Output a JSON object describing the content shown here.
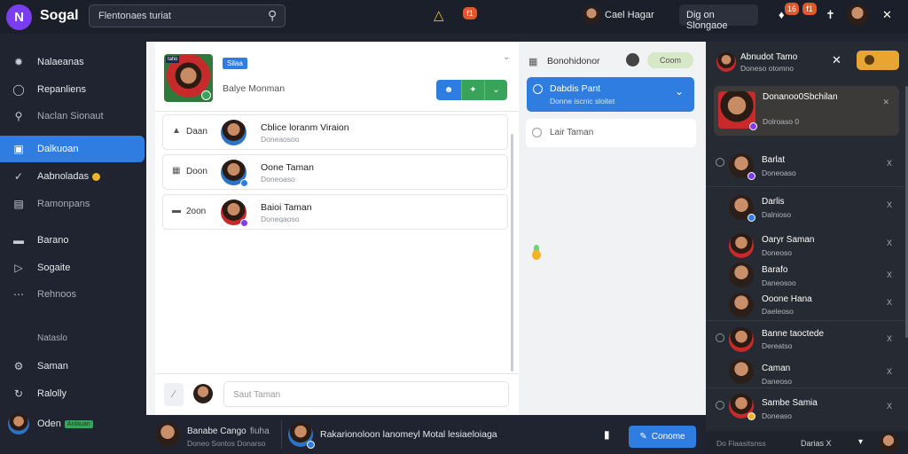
{
  "app": {
    "logo_glyph": "N",
    "name": "Sogal"
  },
  "search": {
    "value": "Flentonaes turiat"
  },
  "topbar": {
    "alert_badge": "f1",
    "user_name": "Cael Hagar",
    "sign_in_text": "Dig on Slongaoe",
    "notif_badge_1": "16",
    "notif_badge_2": "f1"
  },
  "sidebar": {
    "items": [
      {
        "icon": "settings-icon",
        "label": "Nalaeanas"
      },
      {
        "icon": "chat-icon",
        "label": "Repanliens"
      },
      {
        "icon": "search-icon",
        "label": "Naclan Sionaut"
      },
      {
        "icon": "dashboard-icon",
        "label": "Dalkuoan"
      },
      {
        "icon": "check-icon",
        "label": "Aabnoladas"
      },
      {
        "icon": "stats-icon",
        "label": "Ramonpans"
      },
      {
        "icon": "layers-icon",
        "label": "Barano"
      },
      {
        "icon": "play-icon",
        "label": "Sogaite"
      },
      {
        "icon": "more-icon",
        "label": "Rehnoos"
      }
    ],
    "section_header": "Nataslo",
    "bottom_items": [
      {
        "icon": "gear-icon",
        "label": "Saman"
      },
      {
        "icon": "refresh-icon",
        "label": "Ralolly"
      }
    ],
    "profile": {
      "name": "Oden",
      "tag": "Anlauan"
    }
  },
  "left_panel": {
    "header": {
      "tag": "Silaa",
      "subtitle": "Balye Monman",
      "mini_tag": "tatio"
    },
    "rows": [
      {
        "icon": "home-icon",
        "label": "Daan",
        "name": "Cblice loranm Viraion",
        "sub": "Doneaosoo"
      },
      {
        "icon": "doc-icon",
        "label": "Doon",
        "name": "Oone Taman",
        "sub": "Doneoaso"
      },
      {
        "icon": "list-icon",
        "label": "2oon",
        "name": "Baioi Taman",
        "sub": "Doneqaoso"
      }
    ],
    "composer": {
      "placeholder": "Saut Taman"
    }
  },
  "mid_panel": {
    "title": "Bonohidonor",
    "toggle_label": "Coom",
    "selected": {
      "title": "Dabdis Pant",
      "sub": "Donne iscnic sloitet"
    },
    "item": "Lair Taman"
  },
  "right_panel": {
    "header_name": "Abnudot Tamo",
    "header_sub": "Doneso otomno",
    "featured": {
      "name": "Donanoo0Sbchilan",
      "sub": "Dolroaso 0"
    },
    "contacts": [
      {
        "name": "Barlat",
        "sub": "Doneoaso",
        "x": "X"
      },
      {
        "name": "Darlis",
        "sub": "Dalnioso",
        "x": "X"
      },
      {
        "name": "Oaryr Saman",
        "sub": "Doneoso",
        "x": "X"
      },
      {
        "name": "Barafo",
        "sub": "Daneosoo",
        "x": "X"
      },
      {
        "name": "Ooone Hana",
        "sub": "Daeleoso",
        "x": "X"
      },
      {
        "name": "Banne taoctede",
        "sub": "Dereatso",
        "x": "X"
      },
      {
        "name": "Caman",
        "sub": "Daneoso",
        "x": "X"
      },
      {
        "name": "Sambe Samia",
        "sub": "Doneaso",
        "x": "X"
      }
    ],
    "footer_left": "Do Flaasitsnss",
    "footer_right": "Darias X"
  },
  "bottom_bar": {
    "user_name": "Banabe Cango",
    "user_tag": "fiuha",
    "user_sub": "Doneo Sontos Donarso",
    "message": "Rakarionoloon lanomeyl Motal lesiaeloiaga",
    "send_label": "Conome"
  },
  "colors": {
    "accent": "#2f7de1",
    "brand": "#7b3df0",
    "green": "#3aa35a",
    "alert": "#e2582e"
  }
}
